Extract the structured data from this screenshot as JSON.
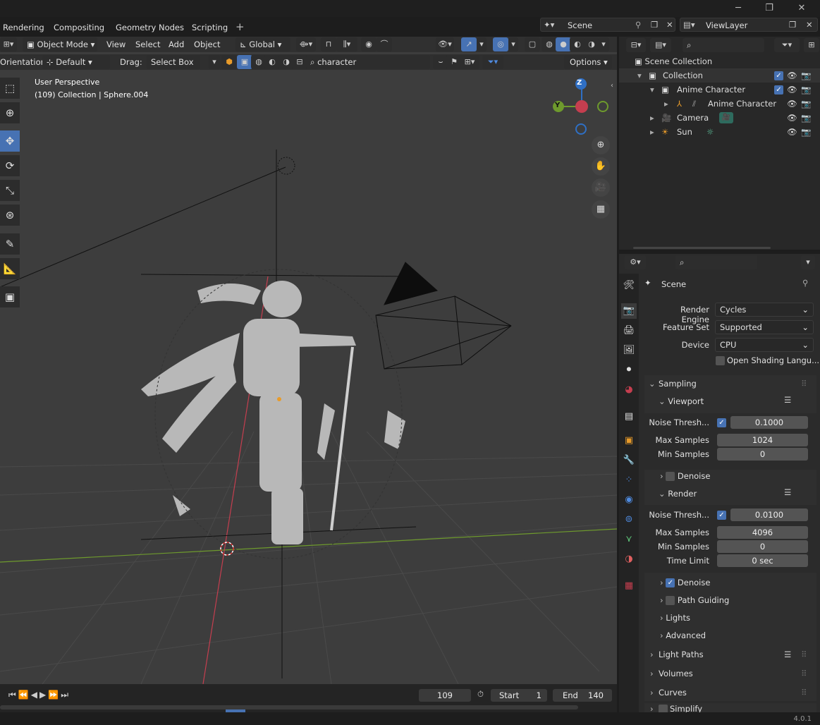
{
  "workspace_tabs": [
    "Rendering",
    "Compositing",
    "Geometry Nodes",
    "Scripting",
    "+"
  ],
  "window_controls": {
    "minimize": "─",
    "maximize": "❐",
    "close": "✕"
  },
  "scene": {
    "name": "Scene"
  },
  "view_layer": {
    "name": "ViewLayer"
  },
  "viewport_header": {
    "mode": "Object Mode",
    "menus": [
      "View",
      "Select",
      "Add",
      "Object"
    ],
    "transform_orientation": "Global"
  },
  "tool_header": {
    "orientation_label": "Orientation:",
    "orientation_value": "Default",
    "drag_label": "Drag:",
    "drag_value": "Select Box",
    "search_value": "character",
    "options_label": "Options"
  },
  "viewport_overlay": {
    "perspective": "User Perspective",
    "collection_info": "(109) Collection | Sphere.004",
    "axis_z": "Z",
    "axis_y": "Y"
  },
  "outliner": {
    "root": "Scene Collection",
    "items": [
      {
        "label": "Collection",
        "icon": "collection-icon"
      },
      {
        "label": "Anime Character",
        "icon": "collection-icon"
      },
      {
        "label": "Anime Character",
        "icon": "armature-icon"
      },
      {
        "label": "Camera",
        "icon": "camera-icon"
      },
      {
        "label": "Sun",
        "icon": "light-icon"
      }
    ]
  },
  "properties": {
    "context": "Scene",
    "render_engine_label": "Render Engine",
    "render_engine": "Cycles",
    "feature_set_label": "Feature Set",
    "feature_set": "Supported",
    "device_label": "Device",
    "device": "CPU",
    "osl_label": "Open Shading Langu...",
    "sampling": "Sampling",
    "viewport": "Viewport",
    "vp_noise_label": "Noise Thresh...",
    "vp_noise": "0.1000",
    "vp_max_label": "Max Samples",
    "vp_max": "1024",
    "vp_min_label": "Min Samples",
    "vp_min": "0",
    "vp_denoise": "Denoise",
    "render": "Render",
    "r_noise_label": "Noise Thresh...",
    "r_noise": "0.0100",
    "r_max_label": "Max Samples",
    "r_max": "4096",
    "r_min_label": "Min Samples",
    "r_min": "0",
    "time_limit_label": "Time Limit",
    "time_limit": "0 sec",
    "r_denoise": "Denoise",
    "path_guiding": "Path Guiding",
    "lights": "Lights",
    "advanced": "Advanced",
    "light_paths": "Light Paths",
    "volumes": "Volumes",
    "curves": "Curves",
    "simplify": "Simplify"
  },
  "timeline": {
    "current_frame": "109",
    "start_label": "Start",
    "start": "1",
    "end_label": "End",
    "end": "140"
  },
  "version": "4.0.1",
  "colors": {
    "accent": "#4772b3",
    "x_axis": "#c53e4f",
    "y_axis": "#6e9a2d",
    "z_axis": "#2f6fc4"
  }
}
